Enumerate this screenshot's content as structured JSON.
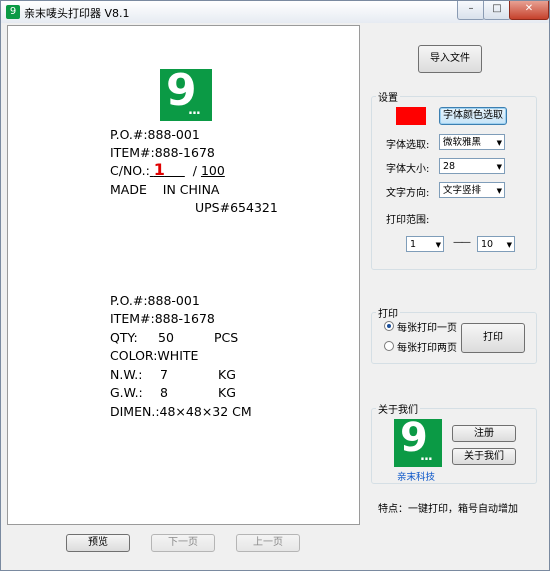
{
  "window": {
    "title": "亲末唛头打印器 V8.1",
    "minimize": "–",
    "maximize": "□",
    "close": "✕"
  },
  "label_preview": {
    "top": {
      "lines": {
        "po": "P.O.#:888-001",
        "item": "ITEM#:888-1678",
        "cno_prefix": "C/NO.:",
        "cno_current": "1",
        "cno_sep": "/",
        "cno_total": "100",
        "made": "MADE    IN CHINA",
        "ups": "UPS#654321"
      }
    },
    "bottom": {
      "lines": {
        "po": "P.O.#:888-001",
        "item": "ITEM#:888-1678",
        "qty_label": "QTY:",
        "qty_value": "50",
        "qty_unit": "PCS",
        "color": "COLOR:WHITE",
        "nw_label": "N.W.:",
        "nw_value": "7",
        "nw_unit": "KG",
        "gw_label": "G.W.:",
        "gw_value": "8",
        "gw_unit": "KG",
        "dimen": "DIMEN.:48×48×32 CM"
      }
    }
  },
  "nav_buttons": {
    "preview": "预览",
    "next": "下一页",
    "prev": "上一页"
  },
  "import_button": "导入文件",
  "settings": {
    "title": "设置",
    "font_color_button": "字体颜色选取",
    "font_color": "#ff0000",
    "font_select_label": "字体选取:",
    "font_select_value": "微软雅黑",
    "font_size_label": "字体大小:",
    "font_size_value": "28",
    "text_direction_label": "文字方向:",
    "text_direction_value": "文字竖排",
    "print_range_label": "打印范围:",
    "range_from": "1",
    "range_dash": "——",
    "range_to": "10"
  },
  "print": {
    "title": "打印",
    "option_one": "每张打印一页",
    "option_two": "每张打印两页",
    "selected": "option_one",
    "print_button": "打印"
  },
  "about": {
    "title": "关于我们",
    "logo_text": "亲末科技",
    "register_button": "注册",
    "about_button": "关于我们"
  },
  "feature_note": "特点：一键打印，箱号自动增加",
  "colors": {
    "brand_green": "#0b9a45",
    "accent_red": "#e00000"
  }
}
